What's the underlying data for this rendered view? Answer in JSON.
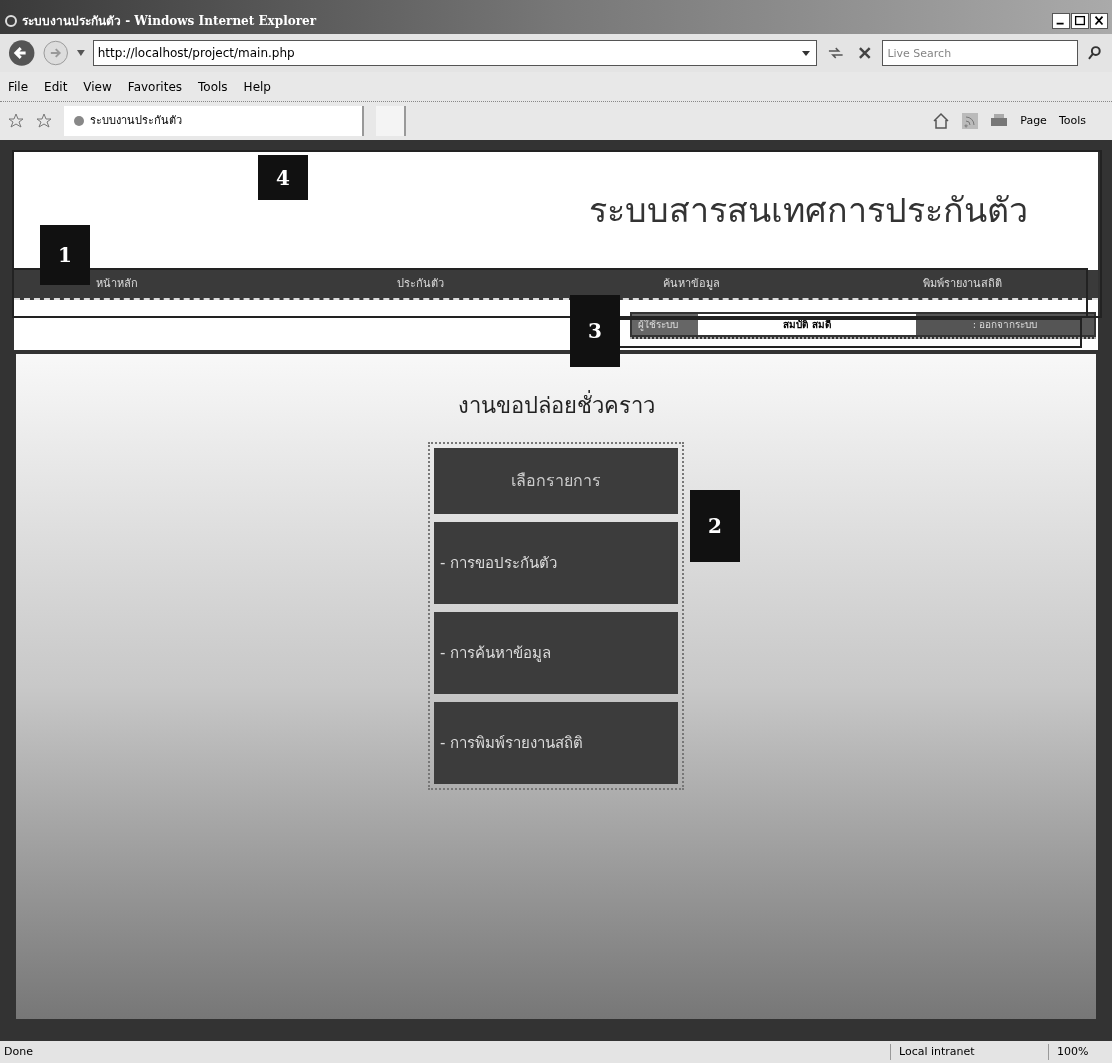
{
  "window": {
    "title": "ระบบงานประกันตัว - Windows Internet Explorer"
  },
  "address_bar": {
    "url": "http://localhost/project/main.php"
  },
  "search": {
    "placeholder": "Live Search"
  },
  "menu_bar": [
    "File",
    "Edit",
    "View",
    "Favorites",
    "Tools",
    "Help"
  ],
  "tab": {
    "title": "ระบบงานประกันตัว"
  },
  "command_bar": [
    "Page",
    "Tools"
  ],
  "page": {
    "header_title": "ระบบสารสนเทศการประกันตัว",
    "nav": [
      "หน้าหลัก",
      "ประกันตัว",
      "ค้นหาข้อมูล",
      "พิมพ์รายงานสถิติ"
    ],
    "user_bar": {
      "label": "ผู้ใช้ระบบ",
      "name": "สมบัติ สมดี",
      "logout": ": ออกจากระบบ"
    },
    "main": {
      "title": "งานขอปล่อยชั่วคราว",
      "menu_header": "เลือกรายการ",
      "items": [
        "- การขอประกันตัว",
        "- การค้นหาข้อมูล",
        "- การพิมพ์รายงานสถิติ"
      ]
    }
  },
  "annotations": [
    "4",
    "1",
    "3",
    "2"
  ],
  "status_bar": {
    "text": "Done",
    "zone": "Local intranet",
    "zoom": "100%"
  }
}
